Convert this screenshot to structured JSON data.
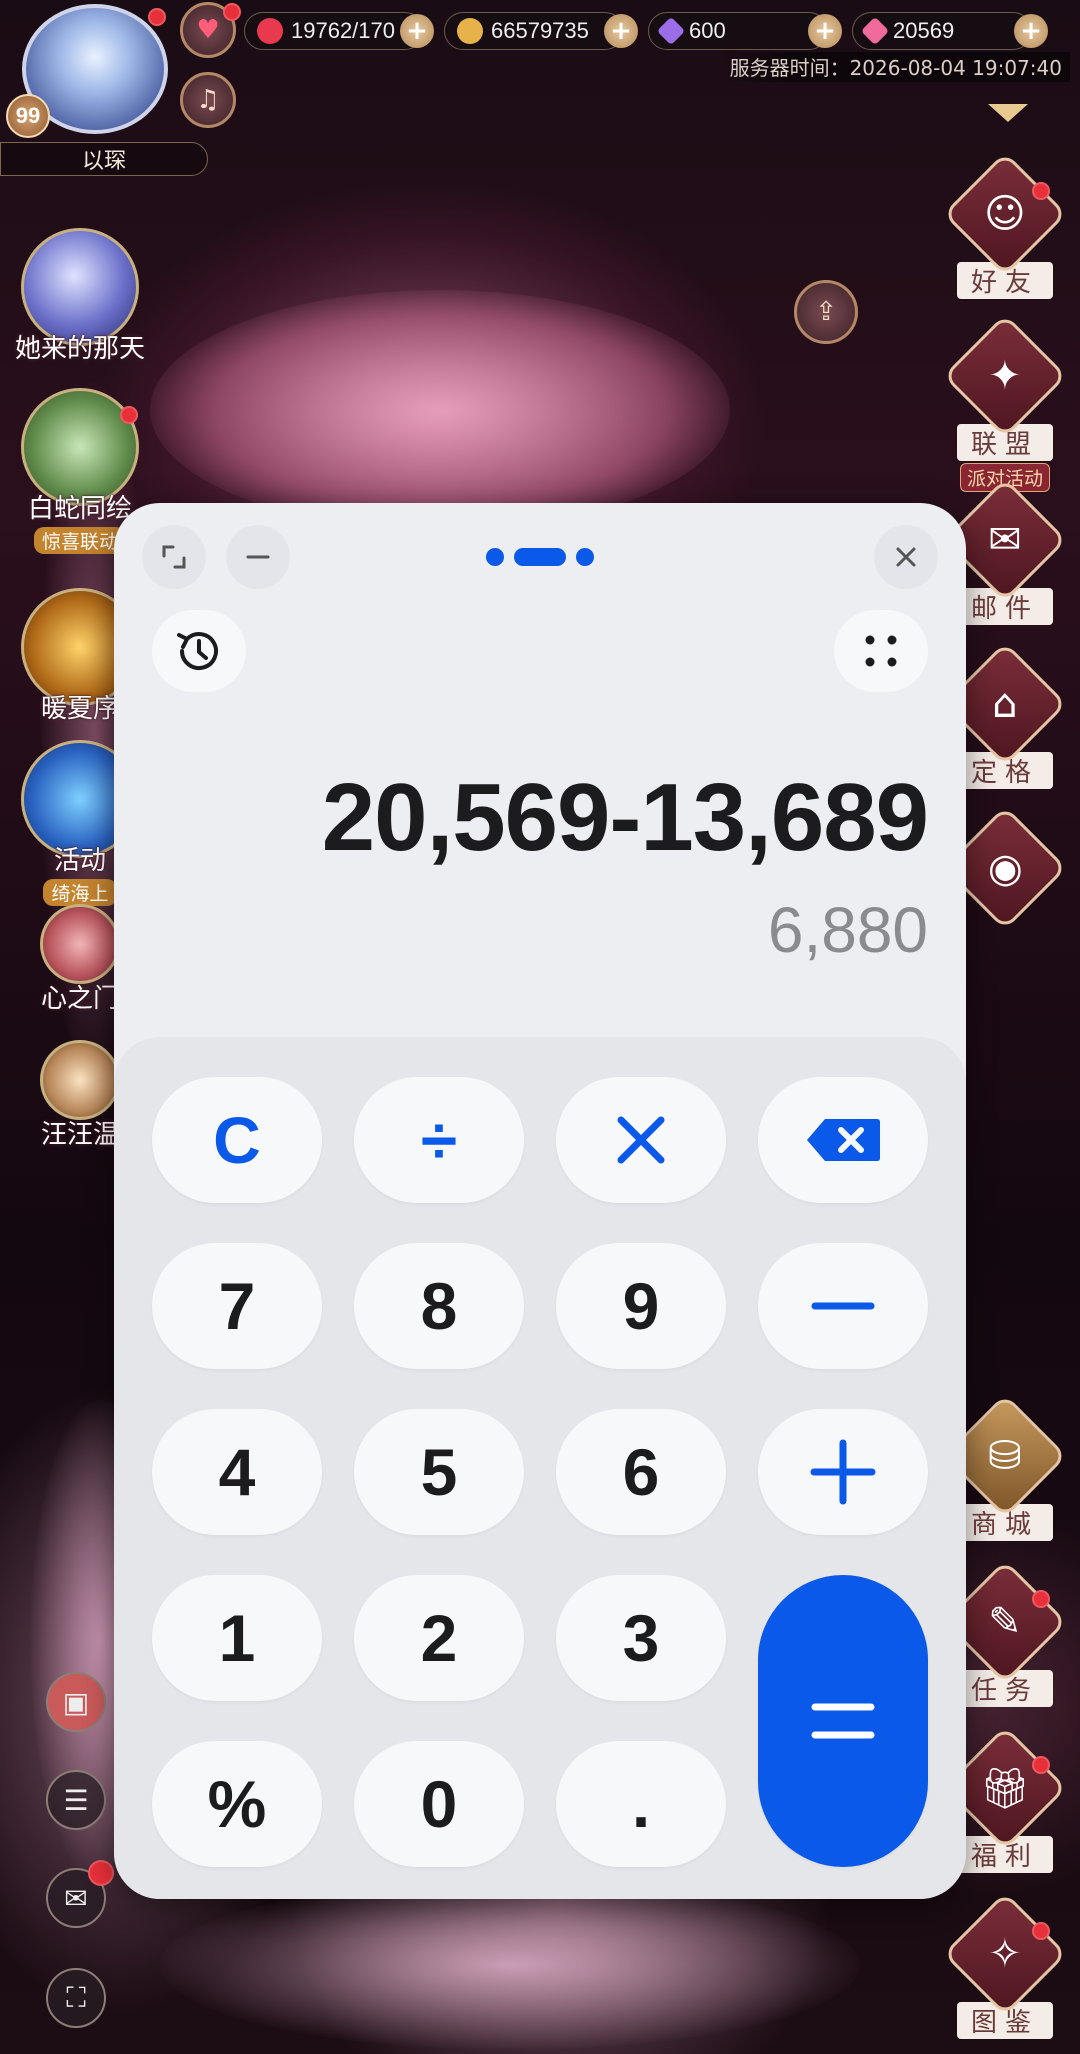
{
  "game": {
    "player_name": "以琛",
    "level": "99",
    "resources": {
      "stamina": "19762/170",
      "coins": "66579735",
      "diamonds": "600",
      "gems": "20569"
    },
    "server_time": "服务器时间：2026-08-04 19:07:40",
    "left_activities": [
      {
        "label": "她来的那天",
        "tag": ""
      },
      {
        "label": "白蛇同绘",
        "tag": "惊喜联动"
      },
      {
        "label": "暖夏序",
        "tag": ""
      },
      {
        "label": "活动",
        "tag": "绮海上"
      },
      {
        "label": "心之门",
        "tag": ""
      },
      {
        "label": "汪汪温",
        "tag": ""
      }
    ],
    "right_menu": [
      {
        "label": "好友",
        "tag": ""
      },
      {
        "label": "联盟",
        "tag": "派对活动"
      },
      {
        "label": "邮件",
        "tag": ""
      },
      {
        "label": "定格",
        "tag": ""
      },
      {
        "label": "",
        "tag": ""
      },
      {
        "label": "商城",
        "tag": ""
      },
      {
        "label": "任务",
        "tag": ""
      },
      {
        "label": "福利",
        "tag": ""
      },
      {
        "label": "图鉴",
        "tag": ""
      }
    ]
  },
  "calculator": {
    "expression": "20,569-13,689",
    "result": "6,880",
    "accent_color": "#0a59e8",
    "keys": {
      "clear": "C",
      "divide": "÷",
      "multiply": "×",
      "backspace": "backspace-icon",
      "seven": "7",
      "eight": "8",
      "nine": "9",
      "minus": "−",
      "four": "4",
      "five": "5",
      "six": "6",
      "plus": "+",
      "one": "1",
      "two": "2",
      "three": "3",
      "equals": "=",
      "percent": "%",
      "zero": "0",
      "decimal": "."
    }
  }
}
